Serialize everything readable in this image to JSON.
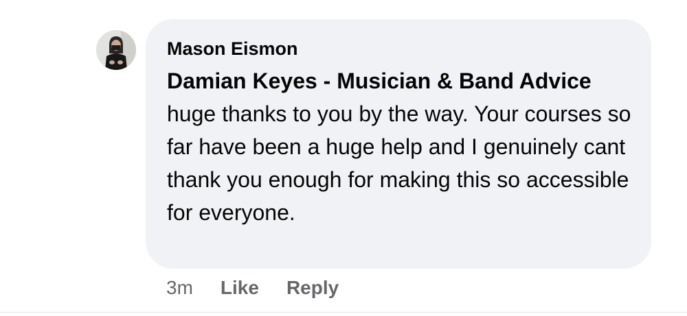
{
  "comment": {
    "author": "Mason Eismon",
    "mention": "Damian Keyes - Musician & Band Advice",
    "body": " huge thanks to you by the way. Your courses so far have been a huge help and I genuinely cant thank you enough for making this so accessible for everyone.",
    "timestamp": "3m",
    "like_label": "Like",
    "reply_label": "Reply"
  },
  "colors": {
    "bubble_background": "#f0f2f5",
    "text": "#050505",
    "secondary_text": "#65676b"
  }
}
